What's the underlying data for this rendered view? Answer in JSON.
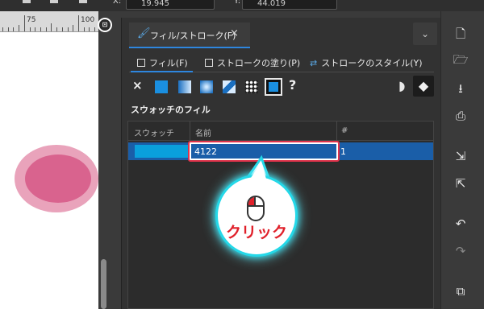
{
  "toolbar": {
    "x_label": "X:",
    "x_value": "19.945",
    "y_label": "Y:",
    "y_value": "44.019"
  },
  "ruler": {
    "ticks": [
      "75",
      "100"
    ]
  },
  "panel": {
    "tab_title": "フィル/ストローク(F)",
    "close_glyph": "×",
    "subtabs": {
      "fill": "フィル(F)",
      "stroke_paint": "ストロークの塗り(P)",
      "stroke_style": "ストロークのスタイル(Y)"
    },
    "fill_types": {
      "none": "×",
      "unset": "?"
    },
    "section_title": "スウォッチのフィル",
    "table": {
      "headers": [
        "スウォッチ",
        "名前",
        "#"
      ],
      "rows": [
        {
          "name": "4122",
          "number": "1",
          "color": "#0aa0dc"
        }
      ]
    }
  },
  "callout": {
    "text": "クリック"
  },
  "colors": {
    "accent": "#2e86de",
    "highlight_border": "#e0324a",
    "callout_glow": "#24d8e8",
    "ellipse_outer": "#e9a3bb",
    "ellipse_inner": "#d9638e"
  },
  "right_toolbar_icons": [
    "new-document-icon",
    "open-icon",
    "save-icon",
    "print-icon",
    "import-icon",
    "export-icon",
    "undo-icon",
    "redo-icon",
    "duplicate-icon"
  ]
}
